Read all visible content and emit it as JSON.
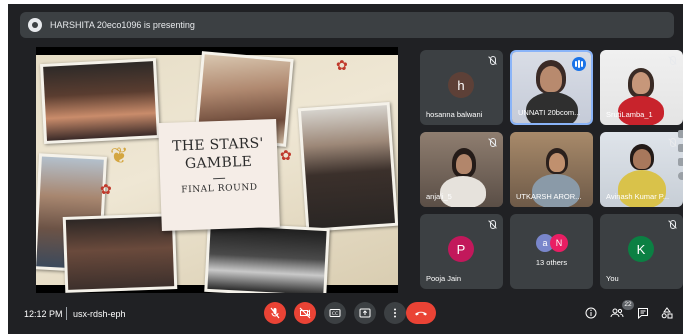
{
  "banner": {
    "text": "HARSHITA 20eco1096 is presenting"
  },
  "slide": {
    "title_line1": "THE STARS'",
    "title_line2": "GAMBLE",
    "subtitle": "FINAL ROUND"
  },
  "tiles": [
    {
      "name": "hosanna balwani",
      "avatar_letter": "h",
      "avatar_color": "#5d4037"
    },
    {
      "name": "UNNATI 20bcom..."
    },
    {
      "name": "SrutiLamba_1"
    },
    {
      "name": "anjali_5"
    },
    {
      "name": "UTKARSH AROR..."
    },
    {
      "name": "Avinash Kumar P..."
    },
    {
      "name": "Pooja Jain",
      "avatar_letter": "P",
      "avatar_color": "#c2185b"
    },
    {
      "name": "13 others",
      "avatar_letters": [
        "a",
        "N"
      ],
      "avatar_colors": [
        "#7986cb",
        "#e91e63"
      ]
    },
    {
      "name": "You",
      "avatar_letter": "K",
      "avatar_color": "#0b8043"
    }
  ],
  "bottom": {
    "time": "12:12 PM",
    "meeting_code": "usx-rdsh-eph",
    "participants_count": "22"
  },
  "controls": [
    "mic-off",
    "camera-off",
    "captions",
    "present",
    "more",
    "end-call"
  ],
  "right_controls": [
    "info",
    "people",
    "chat",
    "activities"
  ],
  "colors": {
    "background": "#202124",
    "tile": "#3c4043",
    "danger": "#ea4335",
    "speaking": "#1a73e8"
  }
}
